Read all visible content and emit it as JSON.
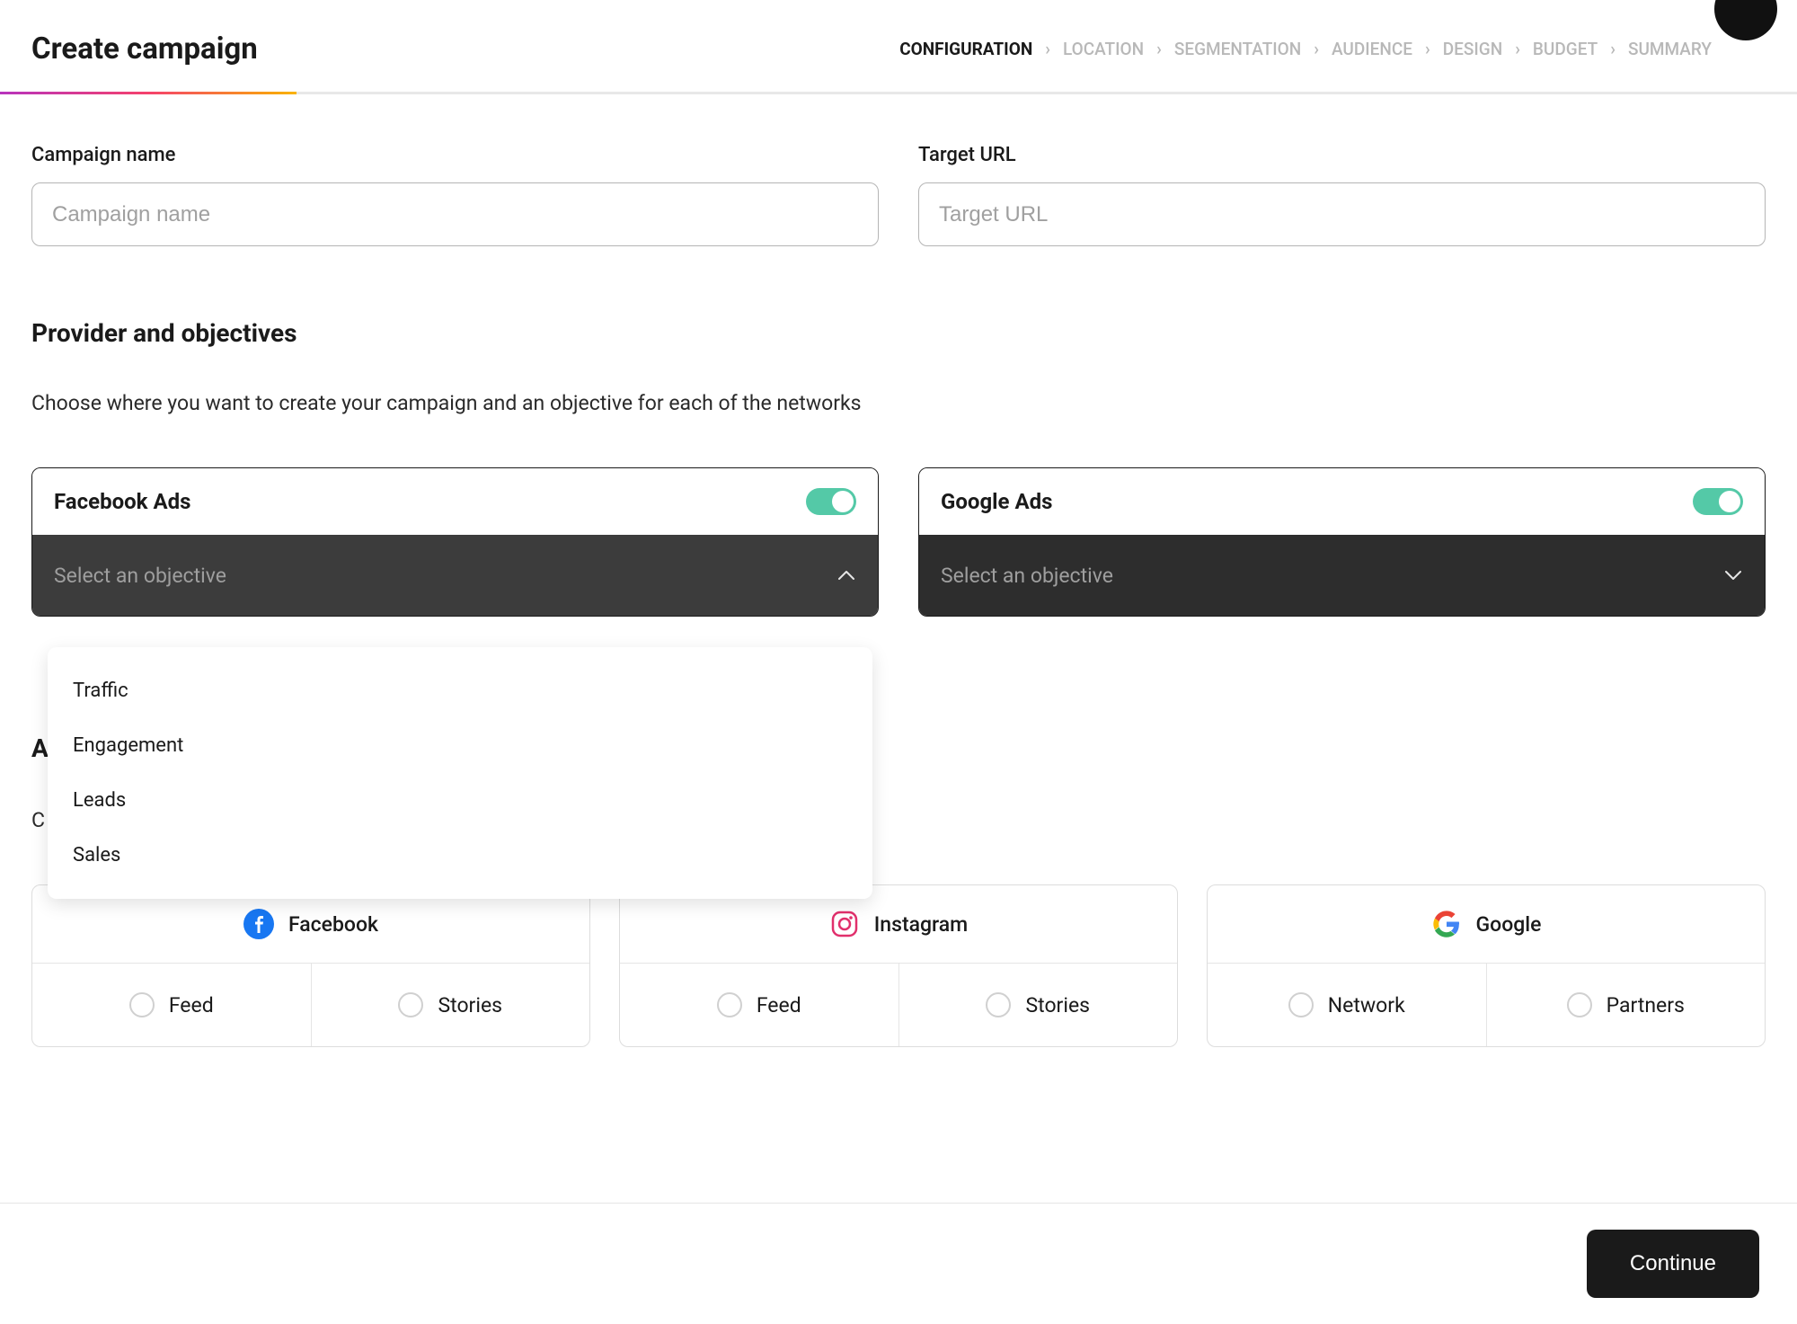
{
  "header": {
    "title": "Create campaign"
  },
  "breadcrumb": {
    "steps": [
      {
        "label": "CONFIGURATION",
        "active": true
      },
      {
        "label": "LOCATION",
        "active": false
      },
      {
        "label": "SEGMENTATION",
        "active": false
      },
      {
        "label": "AUDIENCE",
        "active": false
      },
      {
        "label": "DESIGN",
        "active": false
      },
      {
        "label": "BUDGET",
        "active": false
      },
      {
        "label": "SUMMARY",
        "active": false
      }
    ]
  },
  "fields": {
    "campaign_name": {
      "label": "Campaign name",
      "placeholder": "Campaign name",
      "value": ""
    },
    "target_url": {
      "label": "Target URL",
      "placeholder": "Target URL",
      "value": ""
    }
  },
  "provider_section": {
    "title": "Provider and objectives",
    "subtitle": "Choose where you want to create your campaign and an objective for each of the networks"
  },
  "providers": [
    {
      "name": "Facebook Ads",
      "enabled": true,
      "select_placeholder": "Select an objective",
      "open": true,
      "options": [
        "Traffic",
        "Engagement",
        "Leads",
        "Sales"
      ]
    },
    {
      "name": "Google Ads",
      "enabled": true,
      "select_placeholder": "Select an objective",
      "open": false,
      "options": []
    }
  ],
  "formats_section": {
    "title_partial": "A",
    "subtitle_partial": "C"
  },
  "formats": [
    {
      "brand": "Facebook",
      "options": [
        "Feed",
        "Stories"
      ]
    },
    {
      "brand": "Instagram",
      "options": [
        "Feed",
        "Stories"
      ]
    },
    {
      "brand": "Google",
      "options": [
        "Network",
        "Partners"
      ]
    }
  ],
  "footer": {
    "continue": "Continue"
  }
}
